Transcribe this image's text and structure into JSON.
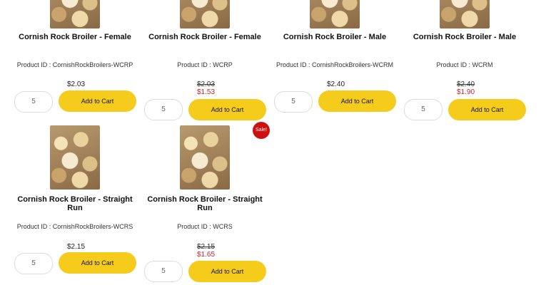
{
  "products": [
    {
      "title": "Cornish Rock Broiler - Female",
      "product_id": "Product ID : CornishRockBroilers-WCRP",
      "price": "$2.03",
      "qty": "5",
      "button": "Add to Cart"
    },
    {
      "title": "Cornish Rock Broiler - Female",
      "product_id": "Product ID : WCRP",
      "old_price": "$2.03",
      "sale_price": "$1.53",
      "qty": "5",
      "button": "Add to Cart"
    },
    {
      "title": "Cornish Rock Broiler - Male",
      "product_id": "Product ID : CornishRockBroilers-WCRM",
      "price": "$2.40",
      "qty": "5",
      "button": "Add to Cart"
    },
    {
      "title": "Cornish Rock Broiler - Male",
      "product_id": "Product ID : WCRM",
      "old_price": "$2.40",
      "sale_price": "$1.90",
      "qty": "5",
      "button": "Add to Cart"
    },
    {
      "title": "Cornish Rock Broiler - Straight Run",
      "product_id": "Product ID : CornishRockBroilers-WCRS",
      "price": "$2.15",
      "qty": "5",
      "button": "Add to Cart"
    },
    {
      "title": "Cornish Rock Broiler - Straight Run",
      "product_id": "Product ID : WCRS",
      "old_price": "$2.15",
      "sale_price": "$1.65",
      "qty": "5",
      "button": "Add to Cart",
      "sale_badge": "Sale!"
    }
  ]
}
